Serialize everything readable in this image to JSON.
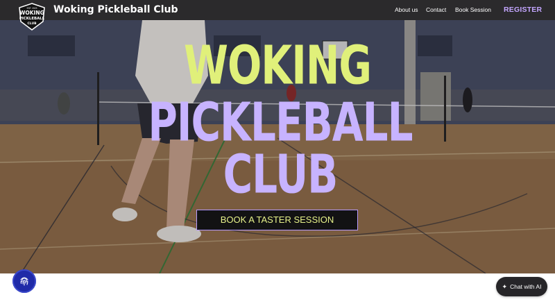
{
  "nav": {
    "brand": "Woking Pickleball Club",
    "logo_text": [
      "EST. 2023",
      "WOKING",
      "PICKLEBALL",
      "CLUB"
    ],
    "links": [
      "About us",
      "Contact",
      "Book Session"
    ],
    "register": "REGISTER"
  },
  "hero": {
    "title_line1": "WOKING",
    "title_line2": "PICKLEBALL",
    "title_line3": "CLUB",
    "cta": "BOOK A TASTER SESSION"
  },
  "chat": {
    "label": "Chat with AI",
    "icon": "sparkle-icon"
  },
  "accessibility": {
    "icon": "fingerprint-icon"
  },
  "colors": {
    "nav_bg": "#2b2a2c",
    "accent_purple": "#c4a6ff",
    "accent_lime": "#e0f07a",
    "cta_bg": "#121213"
  }
}
